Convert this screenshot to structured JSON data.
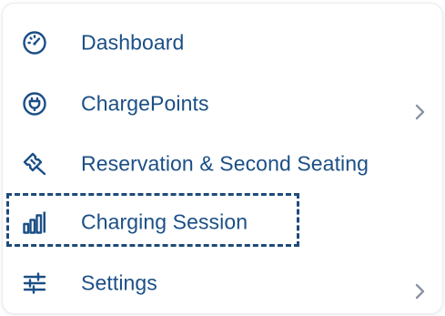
{
  "menu": {
    "items": [
      {
        "label": "Dashboard",
        "icon": "dashboard-gauge-icon",
        "has_submenu": false
      },
      {
        "label": "ChargePoints",
        "icon": "power-plug-icon",
        "has_submenu": true
      },
      {
        "label": "Reservation & Second Seating",
        "icon": "reservation-ticket-icon",
        "has_submenu": false
      },
      {
        "label": "Charging Session",
        "icon": "bar-chart-icon",
        "has_submenu": false,
        "highlighted": true
      },
      {
        "label": "Settings",
        "icon": "sliders-icon",
        "has_submenu": true
      }
    ]
  },
  "colors": {
    "text": "#1b4f86",
    "icon": "#1b4f86",
    "highlight_border": "#1d4b7a",
    "chevron": "#8a94a3"
  }
}
